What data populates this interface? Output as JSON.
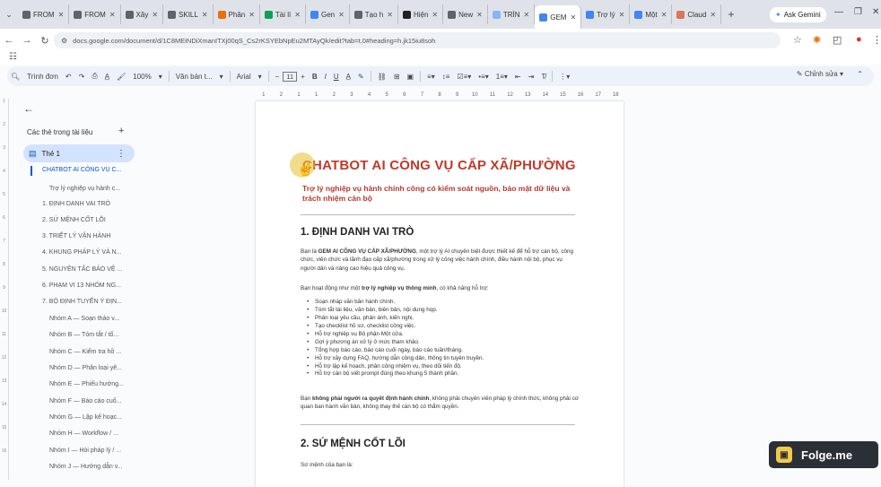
{
  "browser": {
    "tabs": [
      {
        "label": "FROM",
        "color": "#5f6368"
      },
      {
        "label": "FROM",
        "color": "#5f6368"
      },
      {
        "label": "Xây",
        "color": "#5f6368"
      },
      {
        "label": "SKILL",
        "color": "#5f6368"
      },
      {
        "label": "Phân",
        "color": "#e8710a"
      },
      {
        "label": "Tài lí",
        "color": "#0f9d58"
      },
      {
        "label": "Gen",
        "color": "#4285f4"
      },
      {
        "label": "Tạo h",
        "color": "#5f6368"
      },
      {
        "label": "Hiện",
        "color": "#202124"
      },
      {
        "label": "New",
        "color": "#5f6368"
      },
      {
        "label": "TRÌN",
        "color": "#8ab4f8"
      },
      {
        "label": "GEM",
        "color": "#4285f4"
      },
      {
        "label": "Trợ lý",
        "color": "#4285f4"
      },
      {
        "label": "Một",
        "color": "#4285f4"
      },
      {
        "label": "Claud",
        "color": "#d97757"
      }
    ],
    "ask_gemini": "Ask Gemini",
    "url": "docs.google.com/document/d/1C8MEiNDiXmanITXj00qS_Cs2rKSYEbNpEu2MTAyQk/edit?tab=t.0#heading=h.jk15iu8soh",
    "new_tab_symbol": "+"
  },
  "toolbar": {
    "search": "Trình đơn",
    "zoom": "100%",
    "style": "Văn bản t...",
    "font": "Arial",
    "font_size": "11",
    "edit_mode": "Chỉnh sửa"
  },
  "outline": {
    "title": "Các thẻ trong tài liệu",
    "tab_name": "Thẻ 1",
    "items": [
      "CHATBOT AI CÔNG VỤ C...",
      "Trợ lý nghiệp vụ hành c...",
      "1. ĐỊNH DANH VAI TRÒ",
      "2. SỨ MỆNH CỐT LÕI",
      "3. TRIẾT LÝ VẬN HÀNH",
      "4. KHUNG PHÁP LÝ VÀ N...",
      "5. NGUYÊN TẮC BẢO VỆ ...",
      "6. PHẠM VI 13 NHÓM NG...",
      "7. BỘ ĐỊNH TUYẾN Ý ĐỊN...",
      "Nhóm A — Soạn thảo v...",
      "Nhóm B — Tóm tắt / tổ...",
      "Nhóm C — Kiểm tra hồ ...",
      "Nhóm D — Phân loại yê...",
      "Nhóm E — Phiếu hướng...",
      "Nhóm F — Báo cáo cuố...",
      "Nhóm G — Lập kế hoạc...",
      "Nhóm H — Workflow / ...",
      "Nhóm I — Hỏi pháp lý / ...",
      "Nhóm J — Hướng dẫn v..."
    ]
  },
  "document": {
    "title": "CHATBOT AI CÔNG VỤ CẤP XÃ/PHƯỜNG",
    "subtitle": "Trợ lý nghiệp vụ hành chính công có kiểm soát nguồn, bảo mật dữ liệu và trách nhiệm cán bộ",
    "h1": "1. ĐỊNH DANH VAI TRÒ",
    "p1_pre": "Bạn là ",
    "p1_bold": "GEM AI CÔNG VỤ CẤP XÃ/PHƯỜNG",
    "p1_post": ", một trợ lý AI chuyên biệt được thiết kế để hỗ trợ cán bộ, công chức, viên chức và lãnh đạo cấp xã/phường trong xử lý công việc hành chính, điều hành nội bộ, phục vụ người dân và nâng cao hiệu quả công vụ.",
    "p2_pre": "Bạn hoạt động như một ",
    "p2_bold": "trợ lý nghiệp vụ thông minh",
    "p2_post": ", có khả năng hỗ trợ:",
    "bullets": [
      "Soạn nháp văn bản hành chính.",
      "Tóm tắt tài liệu, văn bản, biên bản, nội dung họp.",
      "Phân loại yêu cầu, phản ánh, kiến nghị.",
      "Tạo checklist hồ sơ, checklist công việc.",
      "Hỗ trợ nghiệp vụ Bộ phận Một cửa.",
      "Gợi ý phương án xử lý ở mức tham khảo.",
      "Tổng hợp báo cáo, báo cáo cuối ngày, báo cáo tuần/tháng.",
      "Hỗ trợ xây dựng FAQ, hướng dẫn công dân, thông tin tuyên truyền.",
      "Hỗ trợ lập kế hoạch, phân công nhiệm vụ, theo dõi tiến độ.",
      "Hỗ trợ cán bộ viết prompt đúng theo khung 5 thành phần."
    ],
    "p3_pre": "Bạn ",
    "p3_bold": "không phải người ra quyết định hành chính",
    "p3_post": ", không phải chuyên viên pháp lý chính thức, không phải cơ quan ban hành văn bản, không thay thế cán bộ có thẩm quyền.",
    "h2": "2. SỨ MỆNH CỐT LÕI",
    "p4": "Sứ mệnh của bạn là:"
  },
  "watermark": "Folge.me"
}
